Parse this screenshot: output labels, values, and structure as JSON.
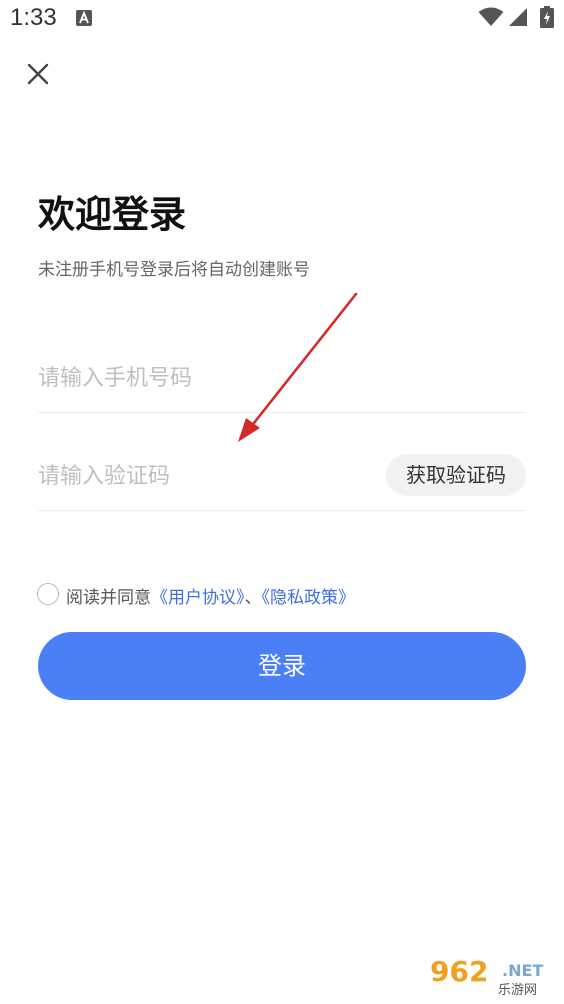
{
  "status_bar": {
    "time": "1:33",
    "notification_icon": "font-a-icon",
    "wifi_icon": "wifi-icon",
    "signal_icon": "signal-icon",
    "battery_icon": "battery-charging-icon"
  },
  "header": {
    "close_icon": "close-icon"
  },
  "login": {
    "title": "欢迎登录",
    "subtitle": "未注册手机号登录后将自动创建账号",
    "phone_placeholder": "请输入手机号码",
    "phone_value": "",
    "code_placeholder": "请输入验证码",
    "code_value": "",
    "get_code_label": "获取验证码",
    "agree_prefix": "阅读并同意",
    "user_agreement": "《用户协议》",
    "separator": "、",
    "privacy_policy": "《隐私政策》",
    "login_label": "登录"
  },
  "watermark": {
    "brand": "962.NET",
    "site": "乐游网"
  },
  "colors": {
    "accent": "#4a7ff5",
    "link": "#3f6fd8",
    "annotation": "#d32a2a"
  }
}
